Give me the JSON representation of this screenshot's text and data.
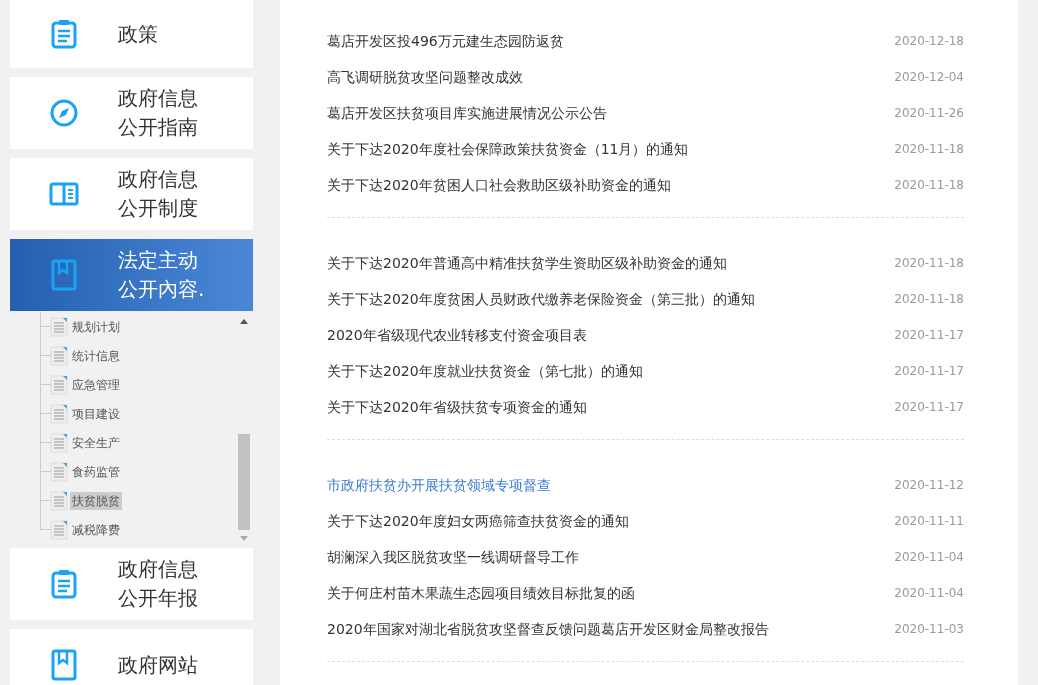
{
  "sidebar": {
    "menu_items": [
      {
        "label": "政策",
        "selected": false
      },
      {
        "label": "政府信息公开指南",
        "selected": false
      },
      {
        "label": "政府信息公开制度",
        "selected": false
      },
      {
        "label": "法定主动公开內容.",
        "selected": true
      }
    ],
    "tree": [
      {
        "label": "规划计划",
        "selected": false
      },
      {
        "label": "统计信息",
        "selected": false
      },
      {
        "label": "应急管理",
        "selected": false
      },
      {
        "label": "项目建设",
        "selected": false
      },
      {
        "label": "安全生产",
        "selected": false
      },
      {
        "label": "食药监管",
        "selected": false
      },
      {
        "label": "扶贫脱贫",
        "selected": true
      },
      {
        "label": "减税降费",
        "selected": false
      }
    ],
    "menu_items_after": [
      {
        "label": "政府信息公开年报",
        "selected": false
      },
      {
        "label": "政府网站",
        "selected": false
      }
    ]
  },
  "news_groups": [
    [
      {
        "title": "葛店开发区投496万元建生态园防返贫",
        "date": "2020-12-18",
        "highlighted": false
      },
      {
        "title": "高飞调研脱贫攻坚问题整改成效",
        "date": "2020-12-04",
        "highlighted": false
      },
      {
        "title": "葛店开发区扶贫项目库实施进展情况公示公告",
        "date": "2020-11-26",
        "highlighted": false
      },
      {
        "title": "关于下达2020年度社会保障政策扶贫资金（11月）的通知",
        "date": "2020-11-18",
        "highlighted": false
      },
      {
        "title": "关于下达2020年贫困人口社会救助区级补助资金的通知",
        "date": "2020-11-18",
        "highlighted": false
      }
    ],
    [
      {
        "title": "关于下达2020年普通高中精准扶贫学生资助区级补助资金的通知",
        "date": "2020-11-18",
        "highlighted": false
      },
      {
        "title": "关于下达2020年度贫困人员财政代缴养老保险资金（第三批）的通知",
        "date": "2020-11-18",
        "highlighted": false
      },
      {
        "title": "2020年省级现代农业转移支付资金项目表",
        "date": "2020-11-17",
        "highlighted": false
      },
      {
        "title": "关于下达2020年度就业扶贫资金（第七批）的通知",
        "date": "2020-11-17",
        "highlighted": false
      },
      {
        "title": "关于下达2020年省级扶贫专项资金的通知",
        "date": "2020-11-17",
        "highlighted": false
      }
    ],
    [
      {
        "title": "市政府扶贫办开展扶贫领域专项督查",
        "date": "2020-11-12",
        "highlighted": true
      },
      {
        "title": "关于下达2020年度妇女两癌筛查扶贫资金的通知",
        "date": "2020-11-11",
        "highlighted": false
      },
      {
        "title": "胡澜深入我区脱贫攻坚一线调研督导工作",
        "date": "2020-11-04",
        "highlighted": false
      },
      {
        "title": "关于何庄村苗木果蔬生态园项目绩效目标批复的函",
        "date": "2020-11-04",
        "highlighted": false
      },
      {
        "title": "2020年国家对湖北省脱贫攻坚督查反馈问题葛店开发区财金局整改报告",
        "date": "2020-11-03",
        "highlighted": false
      }
    ]
  ]
}
